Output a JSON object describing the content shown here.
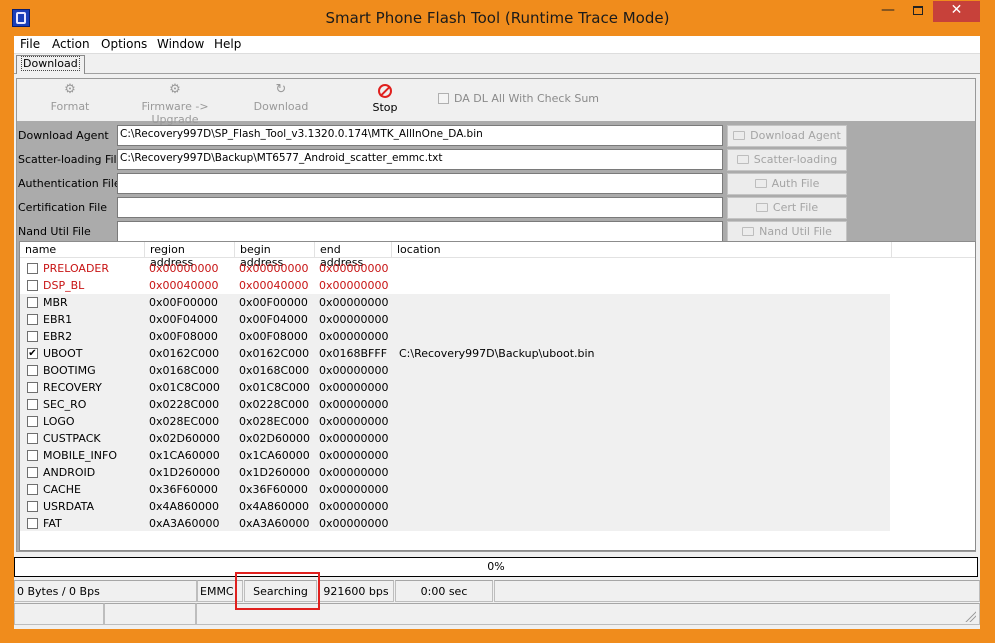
{
  "window": {
    "title": "Smart Phone Flash Tool (Runtime Trace Mode)",
    "minimize": "—",
    "close": "✕"
  },
  "menu": [
    "File",
    "Action",
    "Options",
    "Window",
    "Help"
  ],
  "tab": {
    "label": "Download"
  },
  "toolbar": {
    "format": "Format",
    "firmware_upgrade": "Firmware -> Upgrade",
    "download": "Download",
    "stop": "Stop",
    "checksum_label": "DA DL All With Check Sum",
    "checksum_checked": false
  },
  "files": [
    {
      "label": "Download Agent",
      "value": "C:\\Recovery997D\\SP_Flash_Tool_v3.1320.0.174\\MTK_AllInOne_DA.bin",
      "button": "Download Agent"
    },
    {
      "label": "Scatter-loading File",
      "value": "C:\\Recovery997D\\Backup\\MT6577_Android_scatter_emmc.txt",
      "button": "Scatter-loading"
    },
    {
      "label": "Authentication File",
      "value": "",
      "button": "Auth File"
    },
    {
      "label": "Certification File",
      "value": "",
      "button": "Cert File"
    },
    {
      "label": "Nand Util File",
      "value": "",
      "button": "Nand Util File"
    }
  ],
  "columns": [
    "name",
    "region address",
    "begin address",
    "end address",
    "location"
  ],
  "rows": [
    {
      "name": "PRELOADER",
      "region": "0x00000000",
      "begin": "0x00000000",
      "end": "0x00000000",
      "location": "",
      "checked": false,
      "red": true
    },
    {
      "name": "DSP_BL",
      "region": "0x00040000",
      "begin": "0x00040000",
      "end": "0x00000000",
      "location": "",
      "checked": false,
      "red": true
    },
    {
      "name": "MBR",
      "region": "0x00F00000",
      "begin": "0x00F00000",
      "end": "0x00000000",
      "location": "",
      "checked": false,
      "red": false
    },
    {
      "name": "EBR1",
      "region": "0x00F04000",
      "begin": "0x00F04000",
      "end": "0x00000000",
      "location": "",
      "checked": false,
      "red": false
    },
    {
      "name": "EBR2",
      "region": "0x00F08000",
      "begin": "0x00F08000",
      "end": "0x00000000",
      "location": "",
      "checked": false,
      "red": false
    },
    {
      "name": "UBOOT",
      "region": "0x0162C000",
      "begin": "0x0162C000",
      "end": "0x0168BFFF",
      "location": "C:\\Recovery997D\\Backup\\uboot.bin",
      "checked": true,
      "red": false
    },
    {
      "name": "BOOTIMG",
      "region": "0x0168C000",
      "begin": "0x0168C000",
      "end": "0x00000000",
      "location": "",
      "checked": false,
      "red": false
    },
    {
      "name": "RECOVERY",
      "region": "0x01C8C000",
      "begin": "0x01C8C000",
      "end": "0x00000000",
      "location": "",
      "checked": false,
      "red": false
    },
    {
      "name": "SEC_RO",
      "region": "0x0228C000",
      "begin": "0x0228C000",
      "end": "0x00000000",
      "location": "",
      "checked": false,
      "red": false
    },
    {
      "name": "LOGO",
      "region": "0x028EC000",
      "begin": "0x028EC000",
      "end": "0x00000000",
      "location": "",
      "checked": false,
      "red": false
    },
    {
      "name": "CUSTPACK",
      "region": "0x02D60000",
      "begin": "0x02D60000",
      "end": "0x00000000",
      "location": "",
      "checked": false,
      "red": false
    },
    {
      "name": "MOBILE_INFO",
      "region": "0x1CA60000",
      "begin": "0x1CA60000",
      "end": "0x00000000",
      "location": "",
      "checked": false,
      "red": false
    },
    {
      "name": "ANDROID",
      "region": "0x1D260000",
      "begin": "0x1D260000",
      "end": "0x00000000",
      "location": "",
      "checked": false,
      "red": false
    },
    {
      "name": "CACHE",
      "region": "0x36F60000",
      "begin": "0x36F60000",
      "end": "0x00000000",
      "location": "",
      "checked": false,
      "red": false
    },
    {
      "name": "USRDATA",
      "region": "0x4A860000",
      "begin": "0x4A860000",
      "end": "0x00000000",
      "location": "",
      "checked": false,
      "red": false
    },
    {
      "name": "FAT",
      "region": "0xA3A60000",
      "begin": "0xA3A60000",
      "end": "0x00000000",
      "location": "",
      "checked": false,
      "red": false
    }
  ],
  "progress": {
    "text": "0%",
    "value": 0
  },
  "status": {
    "bytes": "0 Bytes / 0 Bps",
    "storage": "EMMC",
    "state": "Searching",
    "baud": "921600 bps",
    "time": "0:00 sec"
  },
  "colors": {
    "frame": "#f08c1c",
    "close_button": "#c7413a",
    "red_rows": "#c81414",
    "highlight": "#e0201e"
  }
}
